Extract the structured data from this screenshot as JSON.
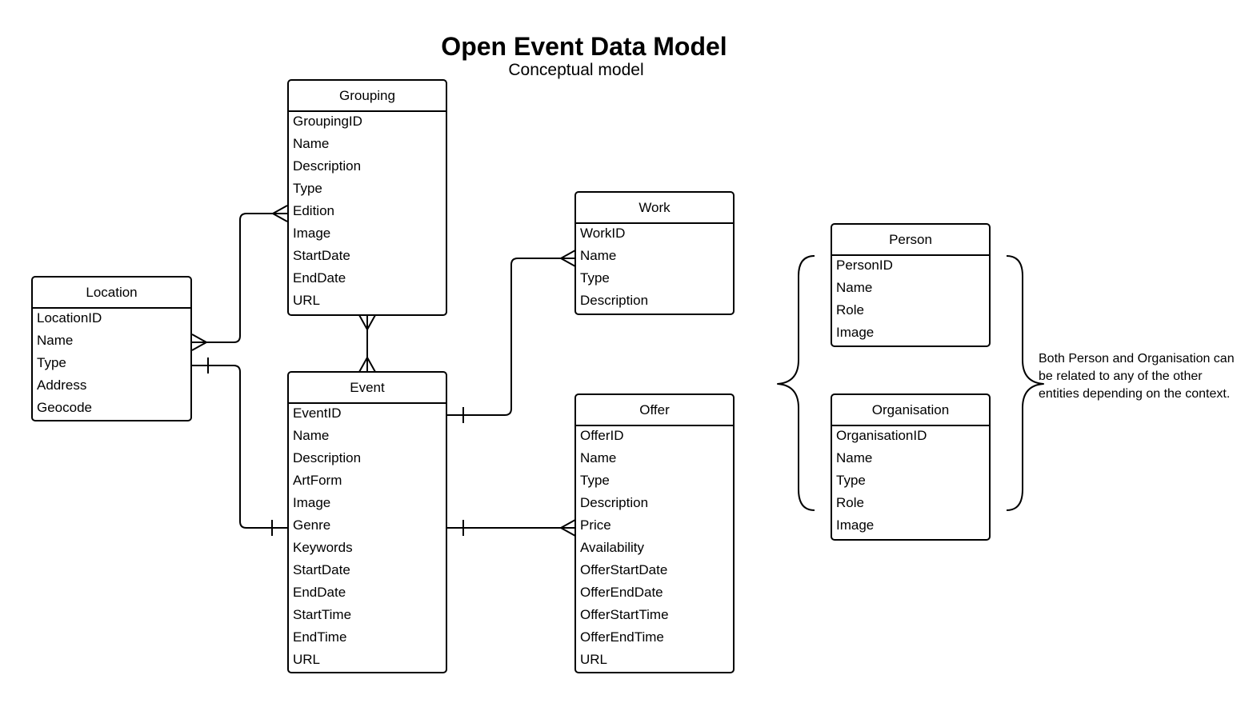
{
  "diagram": {
    "title": "Open Event Data Model",
    "subtitle": "Conceptual model",
    "note": "Both Person and Organisation can be related to any of the other entities depending on the context."
  },
  "entities": {
    "grouping": {
      "name": "Grouping",
      "attributes": [
        "GroupingID",
        "Name",
        "Description",
        "Type",
        "Edition",
        "Image",
        "StartDate",
        "EndDate",
        "URL"
      ]
    },
    "location": {
      "name": "Location",
      "attributes": [
        "LocationID",
        "Name",
        "Type",
        "Address",
        "Geocode"
      ]
    },
    "event": {
      "name": "Event",
      "attributes": [
        "EventID",
        "Name",
        "Description",
        "ArtForm",
        "Image",
        "Genre",
        "Keywords",
        "StartDate",
        "EndDate",
        "StartTime",
        "EndTime",
        "URL"
      ]
    },
    "work": {
      "name": "Work",
      "attributes": [
        "WorkID",
        "Name",
        "Type",
        "Description"
      ]
    },
    "offer": {
      "name": "Offer",
      "attributes": [
        "OfferID",
        "Name",
        "Type",
        "Description",
        "Price",
        "Availability",
        "OfferStartDate",
        "OfferEndDate",
        "OfferStartTime",
        "OfferEndTime",
        "URL"
      ]
    },
    "person": {
      "name": "Person",
      "attributes": [
        "PersonID",
        "Name",
        "Role",
        "Image"
      ]
    },
    "organisation": {
      "name": "Organisation",
      "attributes": [
        "OrganisationID",
        "Name",
        "Type",
        "Role",
        "Image"
      ]
    }
  },
  "relationships": [
    {
      "from": "location",
      "to": "grouping",
      "from_cardinality": "many",
      "to_cardinality": "many"
    },
    {
      "from": "location",
      "to": "event",
      "from_cardinality": "one",
      "to_cardinality": "one"
    },
    {
      "from": "grouping",
      "to": "event",
      "from_cardinality": "many",
      "to_cardinality": "many"
    },
    {
      "from": "event",
      "to": "work",
      "from_cardinality": "one",
      "to_cardinality": "many"
    },
    {
      "from": "event",
      "to": "offer",
      "from_cardinality": "one",
      "to_cardinality": "many"
    }
  ]
}
